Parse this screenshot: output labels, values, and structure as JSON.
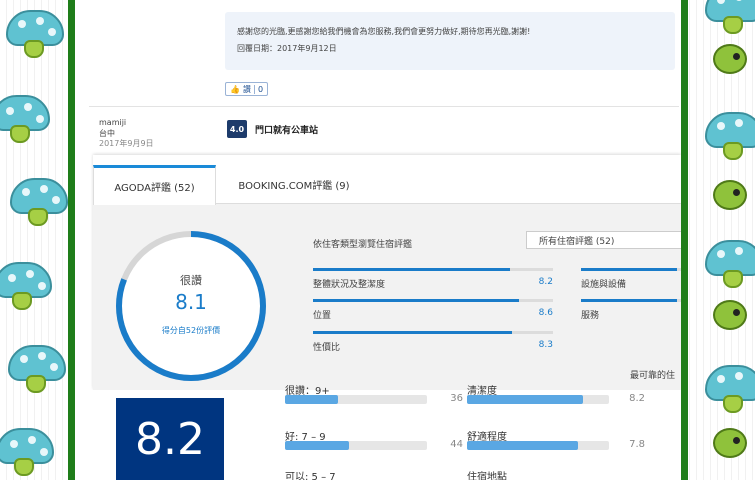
{
  "colors": {
    "frame": "#1f7d1a",
    "accent": "#1a7cc9",
    "booking_blue": "#003580",
    "bar_light": "#5aa7e3"
  },
  "review": {
    "reply_text": "感謝您的光臨,更感謝您給我們機會為您服務,我們會更努力做好,期待您再光臨,謝謝!",
    "reply_date": "回覆日期：2017年9月12日",
    "like_label": "讚",
    "like_count": "0",
    "reviewer_name": "mamiji",
    "reviewer_location": "台中",
    "review_date": "2017年9月9日",
    "score": "4.0",
    "title": "門口就有公車站"
  },
  "tabs": [
    {
      "label": "AGODA評鑑 (52)",
      "active": true
    },
    {
      "label": "BOOKING.COM評鑑 (9)",
      "active": false
    }
  ],
  "summary": {
    "ring_word": "很讚",
    "ring_score": "8.1",
    "ring_fraction": 0.81,
    "ring_sub": "得分自52份評價",
    "filter_label": "依住客類型瀏覽住宿評鑑",
    "filter_value": "所有住宿評鑑 (52)",
    "categories": [
      {
        "name": "整體狀況及整潔度",
        "value": "8.2",
        "fraction": 0.82
      },
      {
        "name": "位置",
        "value": "8.6",
        "fraction": 0.86
      },
      {
        "name": "性價比",
        "value": "8.3",
        "fraction": 0.83
      }
    ],
    "categories_right": [
      {
        "name": "設施與設備",
        "fraction": 0.8
      },
      {
        "name": "服務",
        "fraction": 0.8
      }
    ],
    "reliable_text": "最可靠的住"
  },
  "booking": {
    "score": "8.2",
    "left_rows": [
      {
        "label": "很讚：9+",
        "count": "36",
        "fraction": 0.37
      },
      {
        "label": "好: 7 – 9",
        "count": "44",
        "fraction": 0.45
      },
      {
        "label": "可以: 5 – 7",
        "count": "",
        "fraction": 0.1
      }
    ],
    "right_rows": [
      {
        "label": "清潔度",
        "value": "8.2",
        "fraction": 0.82
      },
      {
        "label": "舒適程度",
        "value": "7.8",
        "fraction": 0.78
      },
      {
        "label": "住宿地點",
        "value": "",
        "fraction": 0.85
      }
    ]
  }
}
